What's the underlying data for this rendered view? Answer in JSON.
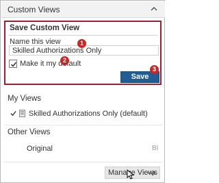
{
  "header": {
    "title": "Custom Views"
  },
  "save_section": {
    "title": "Save Custom View",
    "name_label": "Name this view",
    "name_value": "Skilled Authorizations Only",
    "default_label": "Make it my default",
    "default_checked": true,
    "save_label": "Save"
  },
  "badges": [
    "1",
    "2",
    "3"
  ],
  "my_views": {
    "title": "My Views",
    "items": [
      {
        "label": "Skilled Authorizations Only (default)",
        "checked": true
      }
    ]
  },
  "other_views": {
    "title": "Other Views",
    "items": [
      {
        "label": "Original",
        "tag": "BI"
      }
    ]
  },
  "manage_label": "Manage Views",
  "colors": {
    "highlight_border": "#a31d2c",
    "badge": "#c62828",
    "primary_button": "#1f5e95"
  }
}
